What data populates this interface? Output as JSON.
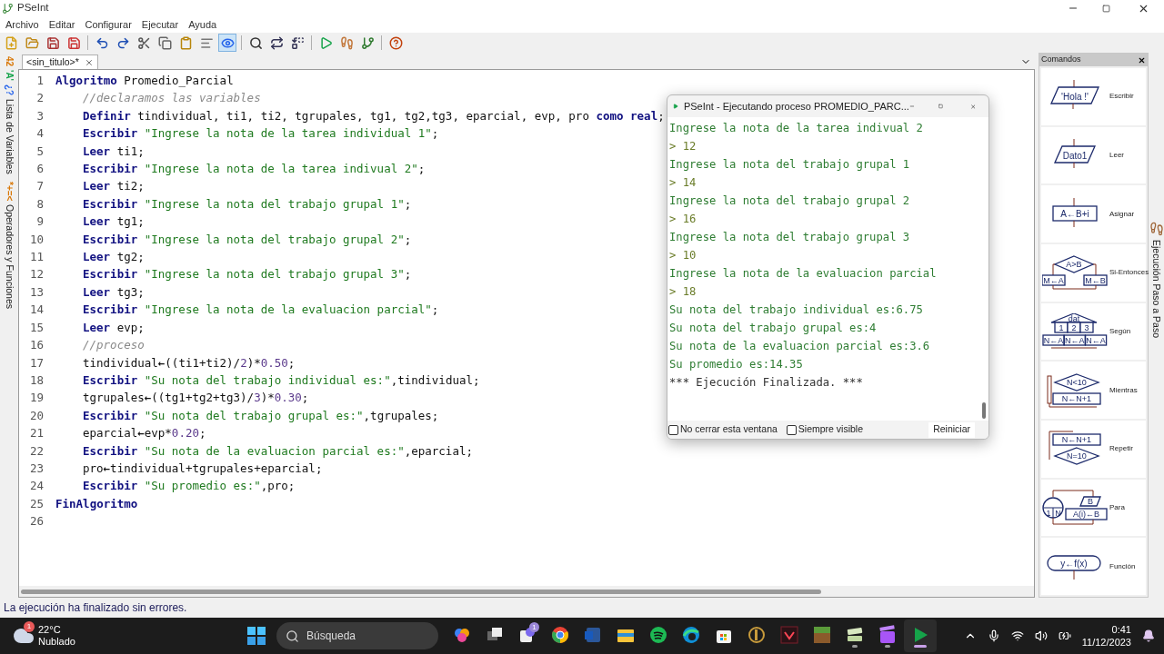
{
  "window": {
    "title": "PSeInt"
  },
  "menu": [
    "Archivo",
    "Editar",
    "Configurar",
    "Ejecutar",
    "Ayuda"
  ],
  "toolbar": [
    {
      "pressed": false
    },
    {
      "pressed": false
    },
    {
      "pressed": false
    },
    {
      "pressed": false
    },
    {
      "pressed": false
    },
    {
      "pressed": false
    },
    {
      "pressed": false
    },
    {
      "pressed": false
    },
    {
      "pressed": false
    },
    {
      "pressed": false
    },
    {
      "pressed": true
    },
    {
      "pressed": false
    },
    {
      "pressed": false
    },
    {
      "pressed": false
    },
    {
      "pressed": false
    },
    {
      "pressed": false
    },
    {
      "pressed": false
    },
    {
      "pressed": false
    }
  ],
  "left_panels": [
    {
      "icon_texts": [
        "42",
        "'A'",
        "¿?"
      ],
      "label": "Lista de Variables"
    },
    {
      "icon_texts": [
        "*+=<"
      ],
      "label": "Operadores y Funciones"
    }
  ],
  "tabs": [
    {
      "label": "<sin_titulo>*",
      "selected": true
    }
  ],
  "code": [
    {
      "n": "1",
      "indented": false,
      "segs": [
        {
          "kind": "kw",
          "text": "Algoritmo"
        },
        {
          "kind": "id",
          "text": " Promedio_Parcial"
        }
      ]
    },
    {
      "n": "2",
      "indented": true,
      "segs": [
        {
          "kind": "cm",
          "text": "//declaramos las variables"
        }
      ]
    },
    {
      "n": "3",
      "indented": true,
      "segs": [
        {
          "kind": "kw",
          "text": "Definir"
        },
        {
          "kind": "id",
          "text": " tindividual, ti1, ti2, tgrupales, tg1, tg2,tg3, eparcial, evp, pro "
        },
        {
          "kind": "kw",
          "text": "como real"
        },
        {
          "kind": "id",
          "text": ";"
        }
      ]
    },
    {
      "n": "4",
      "indented": true,
      "segs": [
        {
          "kind": "kw",
          "text": "Escribir"
        },
        {
          "kind": "str",
          "text": " \"Ingrese la nota de la tarea individual 1\""
        },
        {
          "kind": "id",
          "text": ";"
        }
      ]
    },
    {
      "n": "5",
      "indented": true,
      "segs": [
        {
          "kind": "kw",
          "text": "Leer"
        },
        {
          "kind": "id",
          "text": " ti1;"
        }
      ]
    },
    {
      "n": "6",
      "indented": true,
      "segs": [
        {
          "kind": "kw",
          "text": "Escribir"
        },
        {
          "kind": "str",
          "text": " \"Ingrese la nota de la tarea indivual 2\""
        },
        {
          "kind": "id",
          "text": ";"
        }
      ]
    },
    {
      "n": "7",
      "indented": true,
      "segs": [
        {
          "kind": "kw",
          "text": "Leer"
        },
        {
          "kind": "id",
          "text": " ti2;"
        }
      ]
    },
    {
      "n": "8",
      "indented": true,
      "segs": [
        {
          "kind": "kw",
          "text": "Escribir"
        },
        {
          "kind": "str",
          "text": " \"Ingrese la nota del trabajo grupal 1\""
        },
        {
          "kind": "id",
          "text": ";"
        }
      ]
    },
    {
      "n": "9",
      "indented": true,
      "segs": [
        {
          "kind": "kw",
          "text": "Leer"
        },
        {
          "kind": "id",
          "text": " tg1;"
        }
      ]
    },
    {
      "n": "10",
      "indented": true,
      "segs": [
        {
          "kind": "kw",
          "text": "Escribir"
        },
        {
          "kind": "str",
          "text": " \"Ingrese la nota del trabajo grupal 2\""
        },
        {
          "kind": "id",
          "text": ";"
        }
      ]
    },
    {
      "n": "11",
      "indented": true,
      "segs": [
        {
          "kind": "kw",
          "text": "Leer"
        },
        {
          "kind": "id",
          "text": " tg2;"
        }
      ]
    },
    {
      "n": "12",
      "indented": true,
      "segs": [
        {
          "kind": "kw",
          "text": "Escribir"
        },
        {
          "kind": "str",
          "text": " \"Ingrese la nota del trabajo grupal 3\""
        },
        {
          "kind": "id",
          "text": ";"
        }
      ]
    },
    {
      "n": "13",
      "indented": true,
      "segs": [
        {
          "kind": "kw",
          "text": "Leer"
        },
        {
          "kind": "id",
          "text": " tg3;"
        }
      ]
    },
    {
      "n": "14",
      "indented": true,
      "segs": [
        {
          "kind": "kw",
          "text": "Escribir"
        },
        {
          "kind": "str",
          "text": " \"Ingrese la nota de la evaluacion parcial\""
        },
        {
          "kind": "id",
          "text": ";"
        }
      ]
    },
    {
      "n": "15",
      "indented": true,
      "segs": [
        {
          "kind": "kw",
          "text": "Leer"
        },
        {
          "kind": "id",
          "text": " evp;"
        }
      ]
    },
    {
      "n": "16",
      "indented": true,
      "segs": [
        {
          "kind": "cm",
          "text": "//proceso"
        }
      ]
    },
    {
      "n": "17",
      "indented": true,
      "segs": [
        {
          "kind": "id",
          "text": "tindividual"
        },
        {
          "kind": "op",
          "text": "←"
        },
        {
          "kind": "id",
          "text": "((ti1+ti2)/"
        },
        {
          "kind": "num",
          "text": "2"
        },
        {
          "kind": "id",
          "text": ")*"
        },
        {
          "kind": "num",
          "text": "0.50"
        },
        {
          "kind": "id",
          "text": ";"
        }
      ]
    },
    {
      "n": "18",
      "indented": true,
      "segs": [
        {
          "kind": "kw",
          "text": "Escribir"
        },
        {
          "kind": "str",
          "text": " \"Su nota del trabajo individual es:\""
        },
        {
          "kind": "id",
          "text": ",tindividual;"
        }
      ]
    },
    {
      "n": "19",
      "indented": true,
      "segs": [
        {
          "kind": "id",
          "text": "tgrupales"
        },
        {
          "kind": "op",
          "text": "←"
        },
        {
          "kind": "id",
          "text": "((tg1+tg2+tg3)/"
        },
        {
          "kind": "num",
          "text": "3"
        },
        {
          "kind": "id",
          "text": ")*"
        },
        {
          "kind": "num",
          "text": "0.30"
        },
        {
          "kind": "id",
          "text": ";"
        }
      ]
    },
    {
      "n": "20",
      "indented": true,
      "segs": [
        {
          "kind": "kw",
          "text": "Escribir"
        },
        {
          "kind": "str",
          "text": " \"Su nota del trabajo grupal es:\""
        },
        {
          "kind": "id",
          "text": ",tgrupales;"
        }
      ]
    },
    {
      "n": "21",
      "indented": true,
      "segs": [
        {
          "kind": "id",
          "text": "eparcial"
        },
        {
          "kind": "op",
          "text": "←"
        },
        {
          "kind": "id",
          "text": "evp*"
        },
        {
          "kind": "num",
          "text": "0.20"
        },
        {
          "kind": "id",
          "text": ";"
        }
      ]
    },
    {
      "n": "22",
      "indented": true,
      "segs": [
        {
          "kind": "kw",
          "text": "Escribir"
        },
        {
          "kind": "str",
          "text": " \"Su nota de la evaluacion parcial es:\""
        },
        {
          "kind": "id",
          "text": ",eparcial;"
        }
      ]
    },
    {
      "n": "23",
      "indented": true,
      "segs": [
        {
          "kind": "id",
          "text": "pro"
        },
        {
          "kind": "op",
          "text": "←"
        },
        {
          "kind": "id",
          "text": "tindividual+tgrupales+eparcial;"
        }
      ]
    },
    {
      "n": "24",
      "indented": true,
      "segs": [
        {
          "kind": "kw",
          "text": "Escribir"
        },
        {
          "kind": "str",
          "text": " \"Su promedio es:\""
        },
        {
          "kind": "id",
          "text": ",pro;"
        }
      ]
    },
    {
      "n": "25",
      "indented": false,
      "segs": [
        {
          "kind": "kw",
          "text": "FinAlgoritmo"
        }
      ]
    },
    {
      "n": "26"
    }
  ],
  "console": {
    "title": "PSeInt - Ejecutando proceso PROMEDIO_PARC...",
    "lines": [
      {
        "kind": "output",
        "text": "Ingrese la nota de la tarea indivual 2"
      },
      {
        "kind": "input",
        "text": "> 12"
      },
      {
        "kind": "output",
        "text": "Ingrese la nota del trabajo grupal 1"
      },
      {
        "kind": "input",
        "text": "> 14"
      },
      {
        "kind": "output",
        "text": "Ingrese la nota del trabajo grupal 2"
      },
      {
        "kind": "input",
        "text": "> 16"
      },
      {
        "kind": "output",
        "text": "Ingrese la nota del trabajo grupal 3"
      },
      {
        "kind": "input",
        "text": "> 10"
      },
      {
        "kind": "output",
        "text": "Ingrese la nota de la evaluacion parcial"
      },
      {
        "kind": "input",
        "text": "> 18"
      },
      {
        "kind": "output",
        "text": "Su nota del trabajo individual es:6.75"
      },
      {
        "kind": "output",
        "text": "Su nota del trabajo grupal es:4"
      },
      {
        "kind": "output",
        "text": "Su nota de la evaluacion parcial es:3.6"
      },
      {
        "kind": "output",
        "text": "Su promedio es:14.35"
      },
      {
        "kind": "end",
        "text": "*** Ejecución Finalizada. ***"
      }
    ],
    "options": [
      {
        "label": "No cerrar esta ventana",
        "checked": false
      },
      {
        "label": "Siempre visible",
        "checked": false
      }
    ],
    "button": "Reiniciar"
  },
  "commands": {
    "title": "Comandos",
    "items": [
      {
        "kind": "write",
        "label": "Escribir",
        "texts": [
          "'Hola !'"
        ]
      },
      {
        "kind": "read",
        "label": "Leer",
        "texts": [
          "Dato1"
        ]
      },
      {
        "kind": "assign",
        "label": "Asignar",
        "texts": [
          "A←B+i"
        ]
      },
      {
        "kind": "if",
        "label": "Si-Entonces",
        "texts": [
          "A>B",
          "M←A",
          "M←B"
        ]
      },
      {
        "kind": "switch",
        "label": "Según",
        "texts": [
          "dat",
          "1",
          "2",
          "3",
          "N←A",
          "N←A",
          "N←A"
        ]
      },
      {
        "kind": "while",
        "label": "Mientras",
        "texts": [
          "N<10",
          "N←N+1"
        ]
      },
      {
        "kind": "repeat",
        "label": "Repetir",
        "texts": [
          "N←N+1",
          "N=10"
        ]
      },
      {
        "kind": "for",
        "label": "Para",
        "texts": [
          "1",
          "N",
          "B",
          "A(i)←B"
        ]
      },
      {
        "kind": "function",
        "label": "Función",
        "texts": [
          "y←f(x)"
        ]
      }
    ]
  },
  "side_tab": {
    "label": "Ejecución Paso a Paso"
  },
  "status_bar": "La ejecución ha finalizado sin errores.",
  "taskbar": {
    "weather": {
      "badge": "1",
      "temp": "22°C",
      "condition": "Nublado"
    },
    "search": {
      "placeholder": "Búsqueda"
    },
    "apps": [
      {
        "kind": "sparkle",
        "running": false,
        "selected": false
      },
      {
        "kind": "windows",
        "running": false,
        "selected": false
      },
      {
        "kind": "chat",
        "running": false,
        "selected": false,
        "badge": "1"
      },
      {
        "kind": "globe",
        "running": false,
        "selected": false
      },
      {
        "kind": "doc",
        "running": false,
        "selected": false
      },
      {
        "kind": "folder",
        "running": false,
        "selected": false
      },
      {
        "kind": "music",
        "running": false,
        "selected": false
      },
      {
        "kind": "wave",
        "running": false,
        "selected": false
      },
      {
        "kind": "bag",
        "running": false,
        "selected": false
      },
      {
        "kind": "ring",
        "running": false,
        "selected": false
      },
      {
        "kind": "mark",
        "running": false,
        "selected": false
      },
      {
        "kind": "blocks",
        "running": false,
        "selected": false
      },
      {
        "kind": "cards",
        "running": true,
        "selected": false
      },
      {
        "kind": "film",
        "running": true,
        "selected": false
      },
      {
        "kind": "play",
        "running": true,
        "selected": true
      }
    ],
    "time": "0:41",
    "date": "11/12/2023"
  }
}
